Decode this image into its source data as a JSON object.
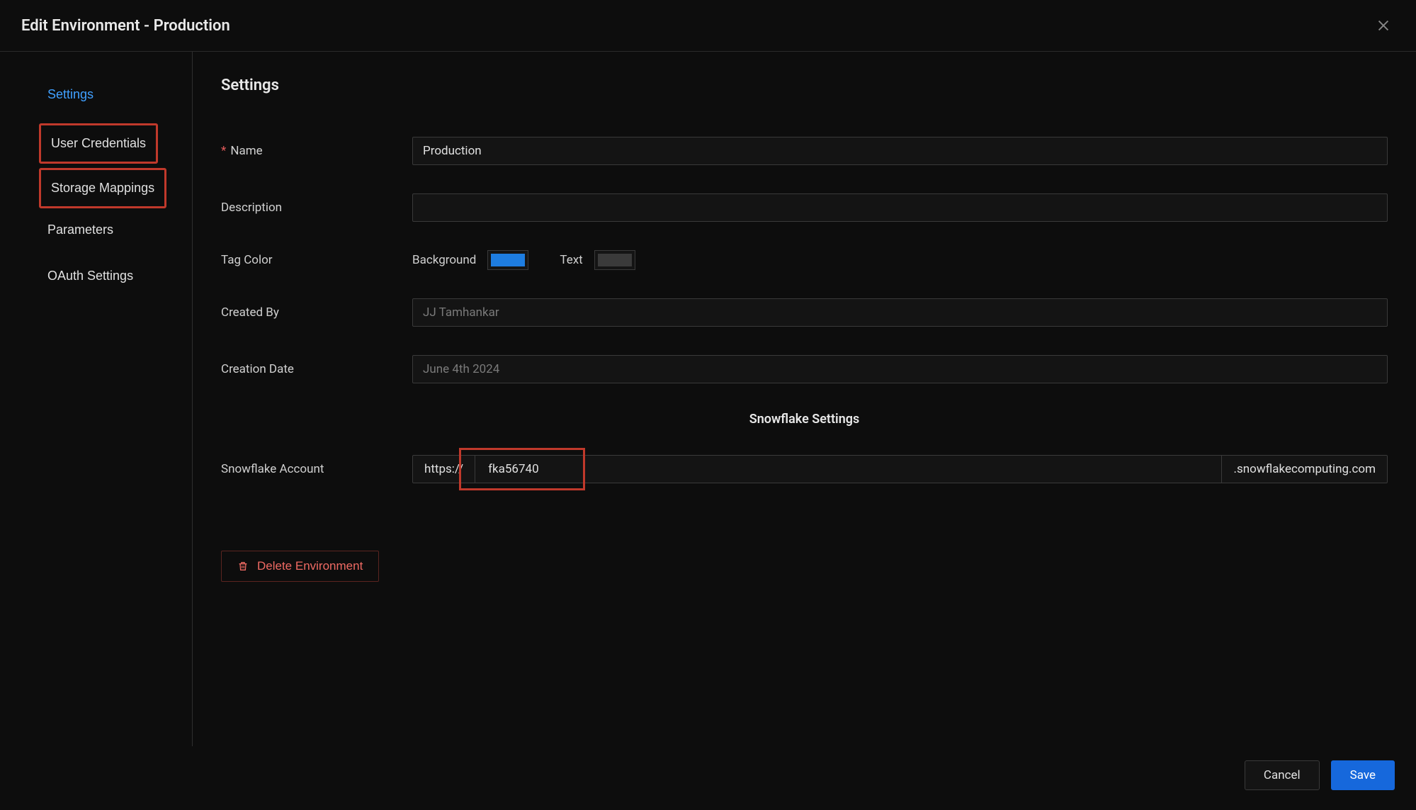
{
  "modal": {
    "title": "Edit Environment - Production"
  },
  "sidebar": {
    "items": [
      {
        "label": "Settings",
        "active": true,
        "highlighted": false
      },
      {
        "label": "User Credentials",
        "active": false,
        "highlighted": true
      },
      {
        "label": "Storage Mappings",
        "active": false,
        "highlighted": true
      },
      {
        "label": "Parameters",
        "active": false,
        "highlighted": false
      },
      {
        "label": "OAuth Settings",
        "active": false,
        "highlighted": false
      }
    ]
  },
  "content": {
    "title": "Settings",
    "fields": {
      "name_label": "Name",
      "name_value": "Production",
      "required_mark": "*",
      "description_label": "Description",
      "description_value": "",
      "tag_color_label": "Tag Color",
      "tag_bg_label": "Background",
      "tag_text_label": "Text",
      "tag_bg_color": "#1e7de0",
      "tag_text_color": "#3a3a3a",
      "created_by_label": "Created By",
      "created_by_value": "JJ Tamhankar",
      "creation_date_label": "Creation Date",
      "creation_date_value": "June 4th 2024"
    },
    "snowflake": {
      "section_title": "Snowflake Settings",
      "account_label": "Snowflake Account",
      "prefix": "https://",
      "value": "fka56740",
      "suffix": ".snowflakecomputing.com"
    },
    "delete_label": "Delete Environment"
  },
  "footer": {
    "cancel": "Cancel",
    "save": "Save"
  }
}
